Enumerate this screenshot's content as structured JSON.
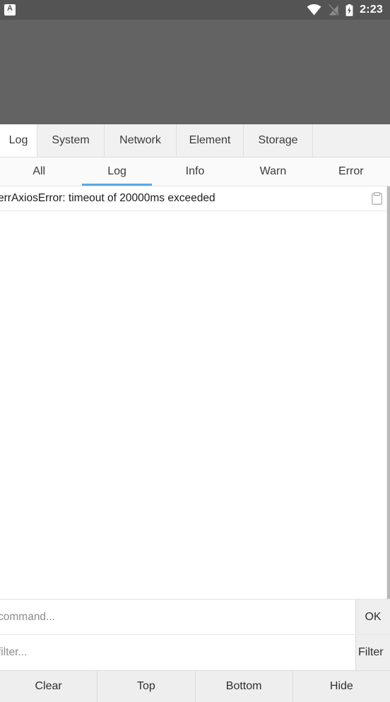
{
  "statusbar": {
    "app_badge_letter": "A",
    "app_badge_dots": "···",
    "time": "2:23",
    "icons": [
      "wifi-icon",
      "no-sim-icon",
      "battery-charging-icon"
    ]
  },
  "devtools": {
    "tabs": [
      {
        "label": "Log",
        "active": true
      },
      {
        "label": "System",
        "active": false
      },
      {
        "label": "Network",
        "active": false
      },
      {
        "label": "Element",
        "active": false
      },
      {
        "label": "Storage",
        "active": false
      }
    ],
    "levels": [
      {
        "label": "All",
        "active": false
      },
      {
        "label": "Log",
        "active": true
      },
      {
        "label": "Info",
        "active": false
      },
      {
        "label": "Warn",
        "active": false
      },
      {
        "label": "Error",
        "active": false
      }
    ],
    "log_entries": [
      {
        "text": "errAxiosError: timeout of 20000ms exceeded",
        "copy_icon": "clipboard-icon"
      }
    ],
    "command": {
      "value": "",
      "placeholder": "command...",
      "button_label": "OK"
    },
    "filter": {
      "value": "",
      "placeholder": "filter...",
      "button_label": "Filter"
    },
    "actions": [
      {
        "label": "Clear"
      },
      {
        "label": "Top"
      },
      {
        "label": "Bottom"
      },
      {
        "label": "Hide"
      }
    ]
  },
  "colors": {
    "statusbar_bg": "#545454",
    "webview_bg": "#636363",
    "tab_bg": "#f1f1f1",
    "active_tab_bg": "#ffffff",
    "subtab_indicator": "#5aa9e6",
    "bottom_bar_bg": "#eeeeee",
    "button_bg": "#efefef"
  }
}
